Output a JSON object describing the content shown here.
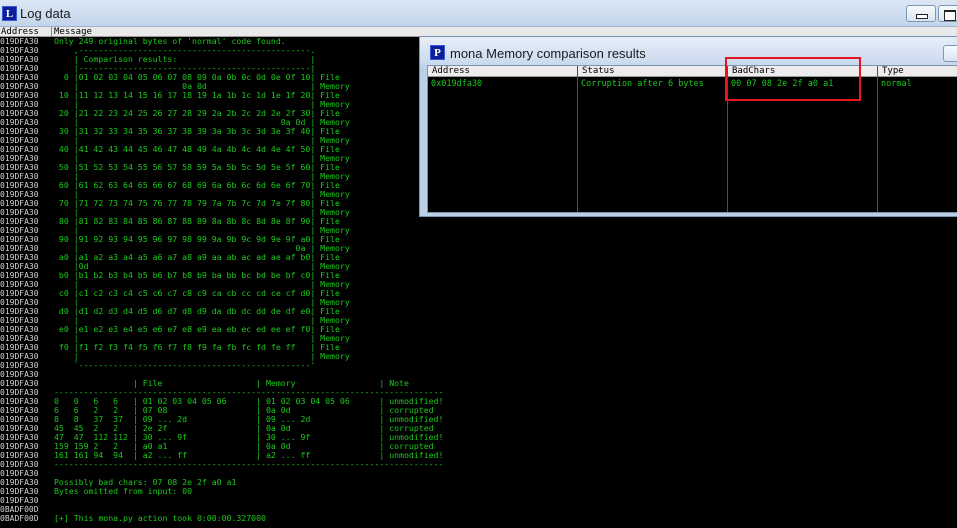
{
  "log_window": {
    "title": "Log data",
    "icon_letter": "L",
    "header": {
      "address": "Address",
      "message": "Message"
    },
    "rows": [
      {
        "addr": "019DFA30",
        "msg": "Only 249 original bytes of 'normal' code found."
      },
      {
        "addr": "019DFA30",
        "msg": "    ,-----------------------------------------------."
      },
      {
        "addr": "019DFA30",
        "msg": "    | Comparison results:                           |"
      },
      {
        "addr": "019DFA30",
        "msg": "    |-----------------------------------------------|"
      },
      {
        "addr": "019DFA30",
        "msg": "  0 |01 02 03 04 05 06 07 08 09 0a 0b 0c 0d 0e 0f 10| File"
      },
      {
        "addr": "019DFA30",
        "msg": "    |                     0a 0d                     | Memory"
      },
      {
        "addr": "019DFA30",
        "msg": " 10 |11 12 13 14 15 16 17 18 19 1a 1b 1c 1d 1e 1f 20| File"
      },
      {
        "addr": "019DFA30",
        "msg": "    |                                               | Memory"
      },
      {
        "addr": "019DFA30",
        "msg": " 20 |21 22 23 24 25 26 27 28 29 2a 2b 2c 2d 2e 2f 30| File"
      },
      {
        "addr": "019DFA30",
        "msg": "    |                                         0a 0d | Memory"
      },
      {
        "addr": "019DFA30",
        "msg": " 30 |31 32 33 34 35 36 37 38 39 3a 3b 3c 3d 3e 3f 40| File"
      },
      {
        "addr": "019DFA30",
        "msg": "    |                                               | Memory"
      },
      {
        "addr": "019DFA30",
        "msg": " 40 |41 42 43 44 45 46 47 48 49 4a 4b 4c 4d 4e 4f 50| File"
      },
      {
        "addr": "019DFA30",
        "msg": "    |                                               | Memory"
      },
      {
        "addr": "019DFA30",
        "msg": " 50 |51 52 53 54 55 56 57 58 59 5a 5b 5c 5d 5e 5f 60| File"
      },
      {
        "addr": "019DFA30",
        "msg": "    |                                               | Memory"
      },
      {
        "addr": "019DFA30",
        "msg": " 60 |61 62 63 64 65 66 67 68 69 6a 6b 6c 6d 6e 6f 70| File"
      },
      {
        "addr": "019DFA30",
        "msg": "    |                                               | Memory"
      },
      {
        "addr": "019DFA30",
        "msg": " 70 |71 72 73 74 75 76 77 78 79 7a 7b 7c 7d 7e 7f 80| File"
      },
      {
        "addr": "019DFA30",
        "msg": "    |                                               | Memory"
      },
      {
        "addr": "019DFA30",
        "msg": " 80 |81 82 83 84 85 86 87 88 89 8a 8b 8c 8d 8e 8f 90| File"
      },
      {
        "addr": "019DFA30",
        "msg": "    |                                               | Memory"
      },
      {
        "addr": "019DFA30",
        "msg": " 90 |91 92 93 94 95 96 97 98 99 9a 9b 9c 9d 9e 9f a0| File"
      },
      {
        "addr": "019DFA30",
        "msg": "    |                                            0a | Memory"
      },
      {
        "addr": "019DFA30",
        "msg": " a0 |a1 a2 a3 a4 a5 a6 a7 a8 a9 aa ab ac ad ae af b0| File"
      },
      {
        "addr": "019DFA30",
        "msg": "    |0d                                             | Memory"
      },
      {
        "addr": "019DFA30",
        "msg": " b0 |b1 b2 b3 b4 b5 b6 b7 b8 b9 ba bb bc bd be bf c0| File"
      },
      {
        "addr": "019DFA30",
        "msg": "    |                                               | Memory"
      },
      {
        "addr": "019DFA30",
        "msg": " c0 |c1 c2 c3 c4 c5 c6 c7 c8 c9 ca cb cc cd ce cf d0| File"
      },
      {
        "addr": "019DFA30",
        "msg": "    |                                               | Memory"
      },
      {
        "addr": "019DFA30",
        "msg": " d0 |d1 d2 d3 d4 d5 d6 d7 d8 d9 da db dc dd de df e0| File"
      },
      {
        "addr": "019DFA30",
        "msg": "    |                                               | Memory"
      },
      {
        "addr": "019DFA30",
        "msg": " e0 |e1 e2 e3 e4 e5 e6 e7 e8 e9 ea eb ec ed ee ef f0| File"
      },
      {
        "addr": "019DFA30",
        "msg": "    |                                               | Memory"
      },
      {
        "addr": "019DFA30",
        "msg": " f0 |f1 f2 f3 f4 f5 f6 f7 f8 f9 fa fb fc fd fe ff   | File"
      },
      {
        "addr": "019DFA30",
        "msg": "    |                                               | Memory"
      },
      {
        "addr": "019DFA30",
        "msg": "    `-----------------------------------------------'"
      },
      {
        "addr": "019DFA30",
        "msg": ""
      },
      {
        "addr": "019DFA30",
        "msg": "                | File                   | Memory                 | Note"
      },
      {
        "addr": "019DFA30",
        "msg": "-------------------------------------------------------------------------------"
      },
      {
        "addr": "019DFA30",
        "msg": "0   0   6   6   | 01 02 03 04 05 06      | 01 02 03 04 05 06      | unmodified!"
      },
      {
        "addr": "019DFA30",
        "msg": "6   6   2   2   | 07 08                  | 0a 0d                  | corrupted"
      },
      {
        "addr": "019DFA30",
        "msg": "8   8   37  37  | 09 ... 2d              | 09 ... 2d              | unmodified!"
      },
      {
        "addr": "019DFA30",
        "msg": "45  45  2   2   | 2e 2f                  | 0a 0d                  | corrupted"
      },
      {
        "addr": "019DFA30",
        "msg": "47  47  112 112 | 30 ... 9f              | 30 ... 9f              | unmodified!"
      },
      {
        "addr": "019DFA30",
        "msg": "159 159 2   2   | a0 a1                  | 0a 0d                  | corrupted"
      },
      {
        "addr": "019DFA30",
        "msg": "161 161 94  94  | a2 ... ff              | a2 ... ff              | unmodified!"
      },
      {
        "addr": "019DFA30",
        "msg": "-------------------------------------------------------------------------------"
      },
      {
        "addr": "019DFA30",
        "msg": ""
      },
      {
        "addr": "019DFA30",
        "msg": "Possibly bad chars: 07 08 2e 2f a0 a1"
      },
      {
        "addr": "019DFA30",
        "msg": "Bytes omitted from input: 00"
      },
      {
        "addr": "019DFA30",
        "msg": ""
      },
      {
        "addr": "0BADF00D",
        "msg": ""
      },
      {
        "addr": "0BADF00D",
        "msg": "[+] This mona.py action took 0:00:00.327000"
      }
    ]
  },
  "mona_window": {
    "title": "mona Memory comparison results",
    "icon_letter": "P",
    "columns": [
      "Address",
      "Status",
      "BadChars",
      "Type"
    ],
    "rows": [
      {
        "address": "0x019dfa30",
        "status": "Corruption after 6 bytes",
        "badchars": "00 07 08 2e 2f a0 a1",
        "type": "normal"
      }
    ]
  },
  "colors": {
    "terminal_bg": "#000000",
    "text_green": "#1bc91b",
    "address_gray": "#d4d4d4",
    "highlight_red": "#e8141e"
  }
}
